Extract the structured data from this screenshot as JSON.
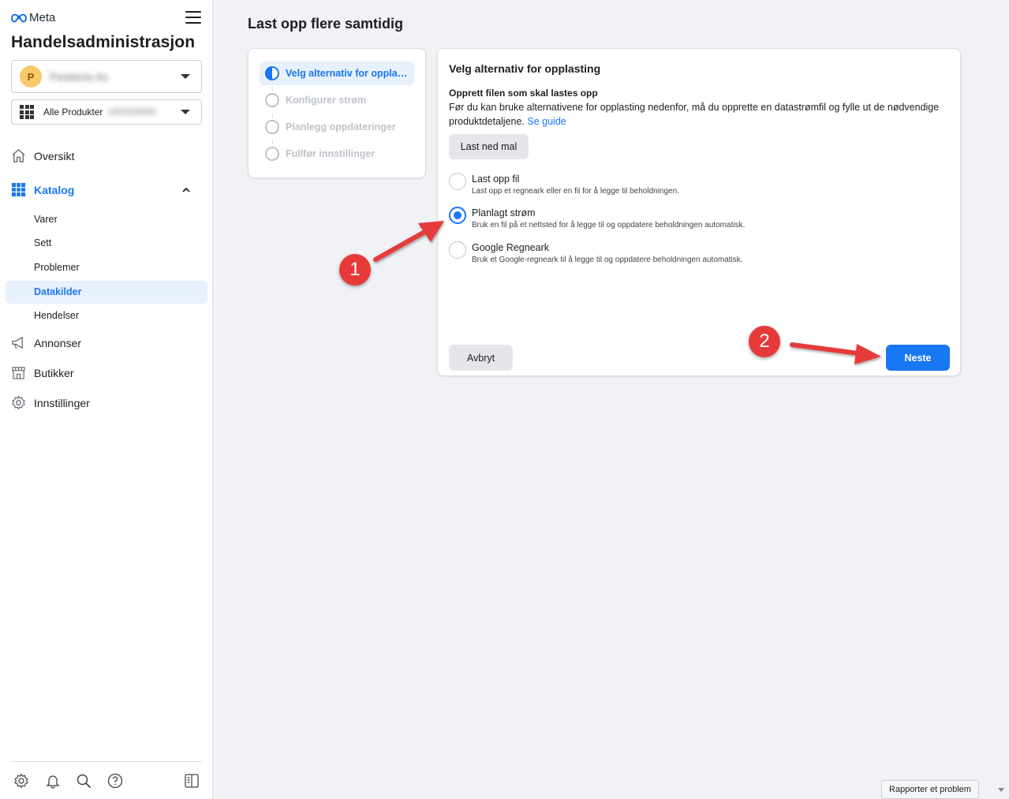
{
  "sidebar": {
    "brand": "Meta",
    "app_title": "Handelsadministrasjon",
    "account": {
      "avatar_letter": "P",
      "name_blurred": "Pandoras As"
    },
    "product_selector": {
      "label": "Alle Produkter",
      "id_blurred": "1301918040"
    },
    "nav": {
      "overview": "Oversikt",
      "catalog": "Katalog",
      "ads": "Annonser",
      "shops": "Butikker",
      "settings": "Innstillinger"
    },
    "catalog_sub": {
      "items": "Varer",
      "sets": "Sett",
      "problems": "Problemer",
      "data_sources": "Datakilder",
      "events": "Hendelser"
    }
  },
  "page": {
    "title": "Last opp flere samtidig"
  },
  "steps": [
    {
      "label": "Velg alternativ for opplasting",
      "state": "active"
    },
    {
      "label": "Konfigurer strøm",
      "state": "pending"
    },
    {
      "label": "Planlegg oppdateringer",
      "state": "pending"
    },
    {
      "label": "Fullfør innstillinger",
      "state": "pending"
    }
  ],
  "main_card": {
    "title": "Velg alternativ for opplasting",
    "subtitle": "Opprett filen som skal lastes opp",
    "description": "Før du kan bruke alternativene for opplasting nedenfor, må du opprette en datastrømfil og fylle ut de nødvendige produktdetaljene.",
    "guide_link": "Se guide",
    "download_button": "Last ned mal",
    "options": [
      {
        "label": "Last opp fil",
        "description": "Last opp et regneark eller en fil for å legge til beholdningen.",
        "selected": false
      },
      {
        "label": "Planlagt strøm",
        "description": "Bruk en fil på et nettsted for å legge til og oppdatere beholdningen automatisk.",
        "selected": true
      },
      {
        "label": "Google Regneark",
        "description": "Bruk et Google-regneark til å legge til og oppdatere beholdningen automatisk.",
        "selected": false
      }
    ],
    "cancel_button": "Avbryt",
    "next_button": "Neste"
  },
  "annotations": {
    "badge_1": "1",
    "badge_2": "2"
  },
  "footer": {
    "report_button": "Rapporter et problem"
  },
  "colors": {
    "accent": "#1877f2",
    "annotation": "#e63a3a",
    "background": "#f0f2f5"
  }
}
